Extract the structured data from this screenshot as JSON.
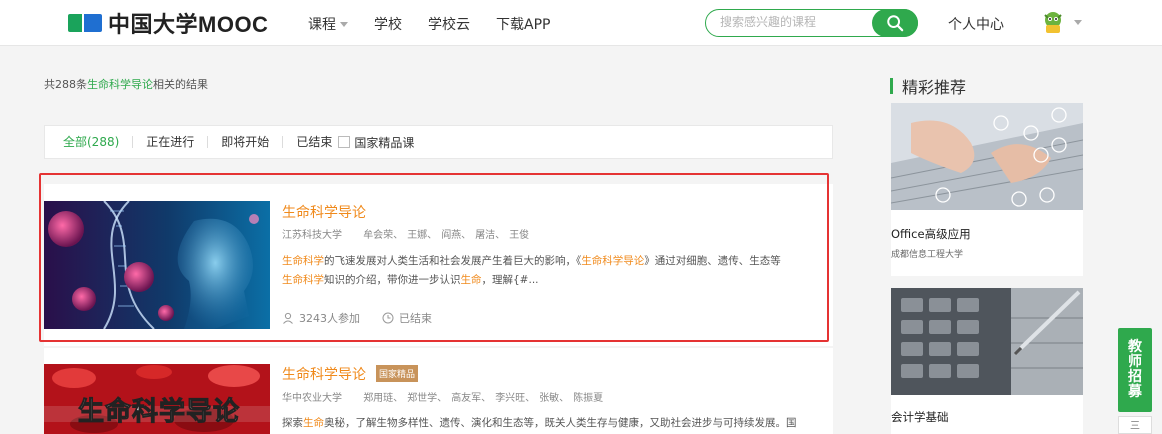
{
  "header": {
    "logo_text": "中国大学MOOC",
    "nav": [
      {
        "label": "课程",
        "dropdown": true
      },
      {
        "label": "学校"
      },
      {
        "label": "学校云"
      },
      {
        "label": "下载APP"
      }
    ],
    "search_placeholder": "搜索感兴趣的课程",
    "personal_center": "个人中心"
  },
  "results": {
    "prefix": "共288条",
    "keyword": "生命科学导论",
    "suffix": "相关的结果"
  },
  "filters": {
    "items": [
      "全部(288)",
      "正在进行",
      "即将开始",
      "已结束"
    ],
    "checkbox_label": "国家精品课"
  },
  "courses": [
    {
      "title": "生命科学导论",
      "school": "江苏科技大学",
      "teachers": [
        "牟会荣、",
        "王娜、",
        "阎燕、",
        "屠洁、",
        "王俊"
      ],
      "desc_parts": [
        "生命科学",
        "的飞速发展对人类生活和社会发展产生着巨大的影响，《",
        "生命科学导论",
        "》通过对细胞、遗传、生态等",
        "生命科学",
        "知识的介绍，带你进一步认识",
        "生命",
        "，理解{#..."
      ],
      "participants": "3243人参加",
      "status": "已结束"
    },
    {
      "title": "生命科学导论",
      "badge": "国家精品",
      "school": "华中农业大学",
      "teachers": [
        "郑用琏、",
        "郑世学、",
        "高友军、",
        "李兴旺、",
        "张敏、",
        "陈振夏"
      ],
      "desc_parts": [
        "探索",
        "生命",
        "奥秘，了解生物多样性、遗传、演化和生态等，既关人类生存与健康，又助社会进步与可持续发展。国"
      ],
      "thumb_text": "生命科学导论"
    }
  ],
  "sidebar": {
    "title": "精彩推荐",
    "items": [
      {
        "name": "Office高级应用",
        "school": "成都信息工程大学"
      },
      {
        "name": "会计学基础",
        "school": ""
      }
    ]
  },
  "float": {
    "teacher_recruit": [
      "教",
      "师",
      "招",
      "募"
    ],
    "bottom_label": "三"
  },
  "colors": {
    "brand_green": "#2fa94d",
    "highlight_orange": "#f08a1c",
    "annotation_red": "#e53333"
  }
}
